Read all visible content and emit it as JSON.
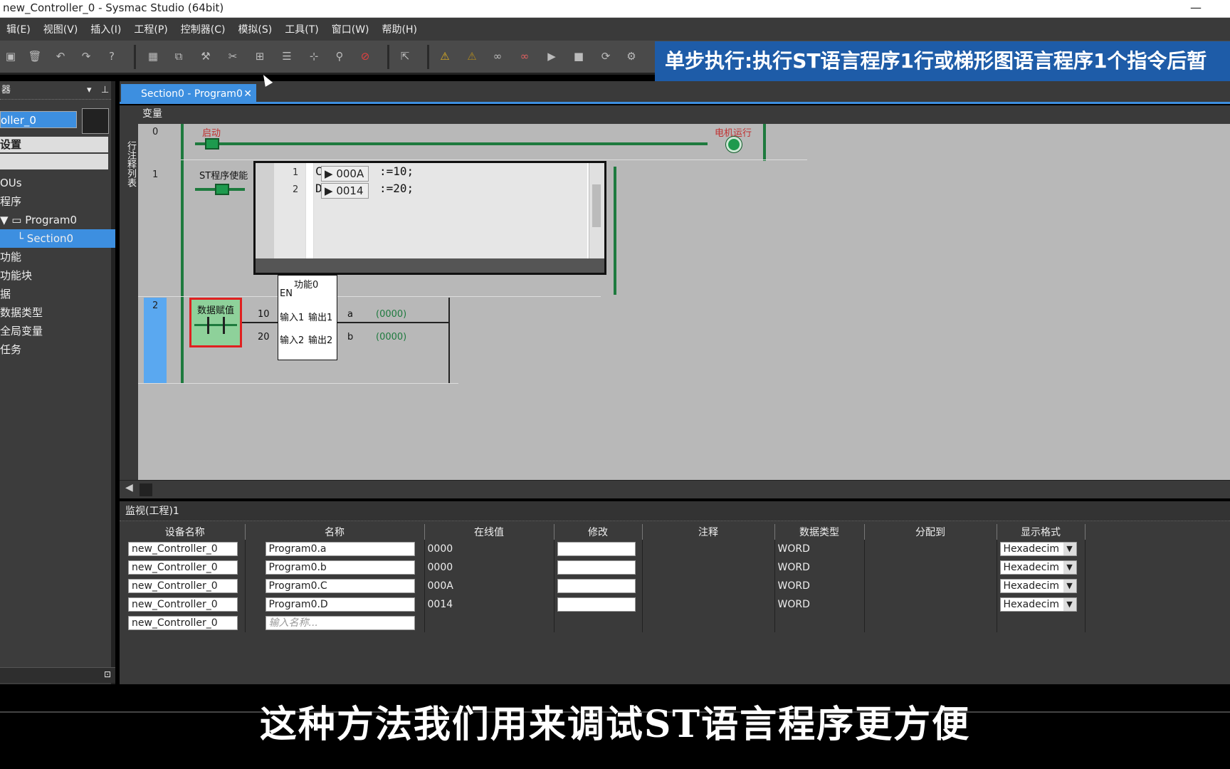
{
  "window": {
    "title": "new_Controller_0 - Sysmac Studio (64bit)",
    "minimize": "—"
  },
  "menu": [
    "辑(E)",
    "视图(V)",
    "插入(I)",
    "工程(P)",
    "控制器(C)",
    "模拟(S)",
    "工具(T)",
    "窗口(W)",
    "帮助(H)"
  ],
  "banner": "单步执行:执行ST语言程序1行或梯形图语言程序1个指令后暂",
  "left_panel": {
    "header": "器",
    "controller": "oller_0",
    "config": "设置",
    "tree": [
      {
        "label": "OUs"
      },
      {
        "label": "程序"
      },
      {
        "label": "▼ ▭ Program0"
      },
      {
        "label": "└ Section0"
      },
      {
        "label": "功能"
      },
      {
        "label": "功能块"
      },
      {
        "label": "据"
      },
      {
        "label": "数据类型"
      },
      {
        "label": "全局变量"
      },
      {
        "label": "任务"
      }
    ]
  },
  "editor": {
    "tab_label": "Section0 - Program0",
    "tab_close": "✕",
    "subheader": "变量",
    "side_label": "行注释列表",
    "rungs": [
      {
        "number": "0",
        "contact_label": "启动",
        "coil_label": "电机运行"
      },
      {
        "number": "1",
        "contact_label": "ST程序使能"
      },
      {
        "number": "2",
        "contact_label": "数据赋值"
      }
    ],
    "st_code": [
      {
        "ln": "1",
        "var": "C",
        "value": "000A",
        "rest": ":=10;"
      },
      {
        "ln": "2",
        "var": "D",
        "value": "0014",
        "rest": ":=20;"
      }
    ],
    "function_block": {
      "title": "功能0",
      "en": "EN",
      "in1": "输入1",
      "in2": "输入2",
      "out1": "输出1",
      "out2": "输出2",
      "in1_val": "10",
      "in2_val": "20",
      "out1_var": "a",
      "out2_var": "b",
      "out1_live": "(0000)",
      "out2_live": "(0000)"
    }
  },
  "monitor": {
    "title": "监视(工程)1",
    "columns": [
      "设备名称",
      "名称",
      "在线值",
      "修改",
      "注释",
      "数据类型",
      "分配到",
      "显示格式"
    ],
    "rows": [
      {
        "device": "new_Controller_0",
        "name": "Program0.a",
        "online": "0000",
        "type": "WORD",
        "format": "Hexadecim"
      },
      {
        "device": "new_Controller_0",
        "name": "Program0.b",
        "online": "0000",
        "type": "WORD",
        "format": "Hexadecim"
      },
      {
        "device": "new_Controller_0",
        "name": "Program0.C",
        "online": "000A",
        "type": "WORD",
        "format": "Hexadecim"
      },
      {
        "device": "new_Controller_0",
        "name": "Program0.D",
        "online": "0014",
        "type": "WORD",
        "format": "Hexadecim"
      }
    ],
    "new_row": {
      "device": "new_Controller_0",
      "placeholder": "输入名称..."
    }
  },
  "subtitle": "这种方法我们用来调试ST语言程序更方便"
}
